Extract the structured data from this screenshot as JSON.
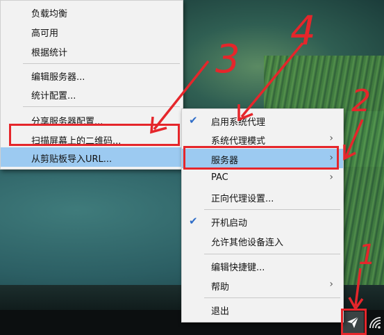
{
  "left_menu": {
    "items": [
      {
        "label": "负载均衡"
      },
      {
        "label": "高可用"
      },
      {
        "label": "根据统计"
      },
      {
        "label": "编辑服务器..."
      },
      {
        "label": "统计配置..."
      },
      {
        "label": "分享服务器配置..."
      },
      {
        "label": "扫描屏幕上的二维码..."
      },
      {
        "label": "从剪贴板导入URL..."
      }
    ]
  },
  "right_menu": {
    "items": [
      {
        "label": "启用系统代理",
        "checked": true
      },
      {
        "label": "系统代理模式",
        "submenu": true
      },
      {
        "label": "服务器",
        "submenu": true,
        "highlighted": true
      },
      {
        "label": "PAC",
        "submenu": true
      },
      {
        "label": "正向代理设置..."
      },
      {
        "label": "开机启动",
        "checked": true
      },
      {
        "label": "允许其他设备连入"
      },
      {
        "label": "编辑快捷键..."
      },
      {
        "label": "帮助",
        "submenu": true
      },
      {
        "label": "退出"
      }
    ]
  },
  "annotations": {
    "step1": "1",
    "step2": "2",
    "step3": "3",
    "step4": "4"
  },
  "icons": {
    "check": "check-icon",
    "submenu": "chevron-right-icon",
    "tray_app": "paper-plane-icon",
    "tray_overflow": "caret-up-icon",
    "tray_wifi": "wifi-icon"
  },
  "colors": {
    "highlight": "#9ccaf1",
    "annotation_red": "#e5262b",
    "check_blue": "#2f6dc8"
  }
}
